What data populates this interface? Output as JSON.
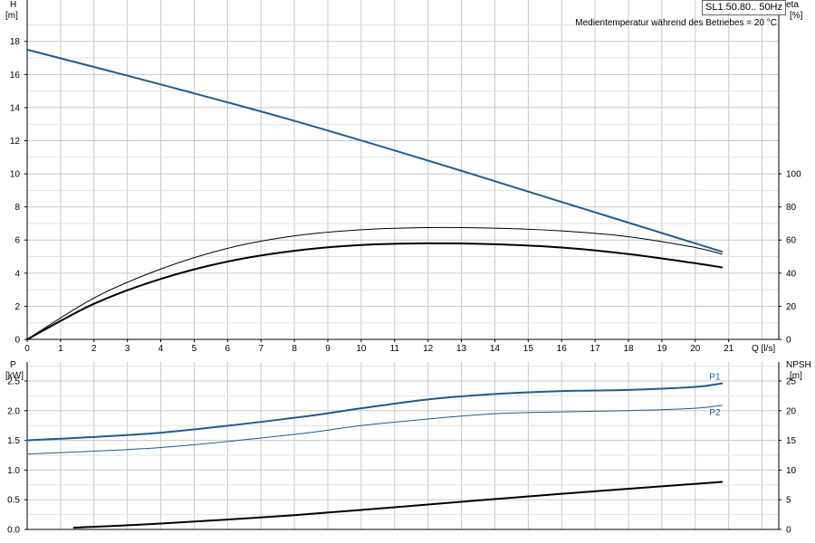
{
  "header": {
    "product_label": "SL1.50.80.. 50Hz",
    "note": "Medientemperatur während des Betriebes = 20 °C"
  },
  "colors": {
    "blue": "#1f5b8f",
    "black": "#000000",
    "grid": "#c8c8c8"
  },
  "chart_data": [
    {
      "type": "line",
      "title": "",
      "xlabel": "Q [l/s]",
      "ylabel_left": [
        "H",
        "[m]"
      ],
      "ylabel_right": [
        "eta",
        "[%]"
      ],
      "xlim": [
        0,
        22.5
      ],
      "ylim_left": [
        0,
        20.5
      ],
      "ylim_right": [
        0,
        205
      ],
      "x_ticks": [
        0,
        1,
        2,
        3,
        4,
        5,
        6,
        7,
        8,
        9,
        10,
        11,
        12,
        13,
        14,
        15,
        16,
        17,
        18,
        19,
        20,
        21
      ],
      "y_ticks_left": [
        0,
        2,
        4,
        6,
        8,
        10,
        12,
        14,
        16,
        18
      ],
      "y_ticks_right": [
        0,
        20,
        40,
        60,
        80,
        100
      ],
      "grid": true,
      "series": [
        {
          "name": "",
          "axis": "left",
          "color": "#1f5b8f",
          "width": 2,
          "x": [
            0,
            4,
            8,
            12,
            16,
            20.8
          ],
          "y": [
            17.5,
            15.4,
            13.2,
            10.8,
            8.3,
            5.3
          ]
        },
        {
          "name": "",
          "axis": "left",
          "color": "#000000",
          "width": 1,
          "x": [
            0,
            2,
            4,
            6,
            8,
            10,
            12,
            14,
            16,
            18,
            20,
            20.8
          ],
          "y": [
            0,
            2.5,
            4.25,
            5.5,
            6.25,
            6.62,
            6.75,
            6.72,
            6.55,
            6.2,
            5.55,
            5.15
          ]
        },
        {
          "name": "",
          "axis": "left",
          "color": "#000000",
          "width": 2,
          "x": [
            0,
            2,
            4,
            6,
            8,
            10,
            12,
            14,
            16,
            18,
            20,
            20.8
          ],
          "y": [
            0,
            2.15,
            3.65,
            4.7,
            5.35,
            5.7,
            5.8,
            5.75,
            5.55,
            5.15,
            4.6,
            4.35
          ]
        }
      ]
    },
    {
      "type": "line",
      "title": "",
      "xlabel": "",
      "ylabel_left": [
        "P",
        "[kW]"
      ],
      "ylabel_right": [
        "NPSH",
        "[m]"
      ],
      "xlim": [
        0,
        22.5
      ],
      "ylim_left": [
        0,
        2.82
      ],
      "ylim_right": [
        0,
        28.2
      ],
      "x_ticks": [
        0,
        1,
        2,
        3,
        4,
        5,
        6,
        7,
        8,
        9,
        10,
        11,
        12,
        13,
        14,
        15,
        16,
        17,
        18,
        19,
        20,
        21
      ],
      "y_ticks_left": [
        "0.0",
        "0.5",
        "1.0",
        "1.5",
        "2.0",
        "2.5"
      ],
      "y_ticks_right": [
        0,
        5,
        10,
        15,
        20,
        25
      ],
      "grid": true,
      "series": [
        {
          "name": "P1",
          "axis": "left",
          "color": "#1f5b8f",
          "width": 2,
          "x": [
            0,
            4,
            8,
            10,
            12,
            14,
            16,
            18,
            20,
            20.8
          ],
          "y": [
            1.5,
            1.63,
            1.88,
            2.04,
            2.19,
            2.28,
            2.33,
            2.35,
            2.4,
            2.46
          ]
        },
        {
          "name": "P2",
          "axis": "left",
          "color": "#1f5b8f",
          "width": 1,
          "x": [
            0,
            4,
            8,
            10,
            12,
            14,
            16,
            18,
            20,
            20.8
          ],
          "y": [
            1.27,
            1.38,
            1.6,
            1.75,
            1.86,
            1.95,
            1.98,
            2.0,
            2.04,
            2.09
          ]
        },
        {
          "name": "",
          "axis": "right",
          "color": "#000000",
          "width": 2,
          "x": [
            1.4,
            4,
            8,
            12,
            16,
            20.8
          ],
          "y": [
            0.3,
            1.0,
            2.4,
            4.2,
            6.0,
            8.0
          ]
        }
      ]
    }
  ]
}
